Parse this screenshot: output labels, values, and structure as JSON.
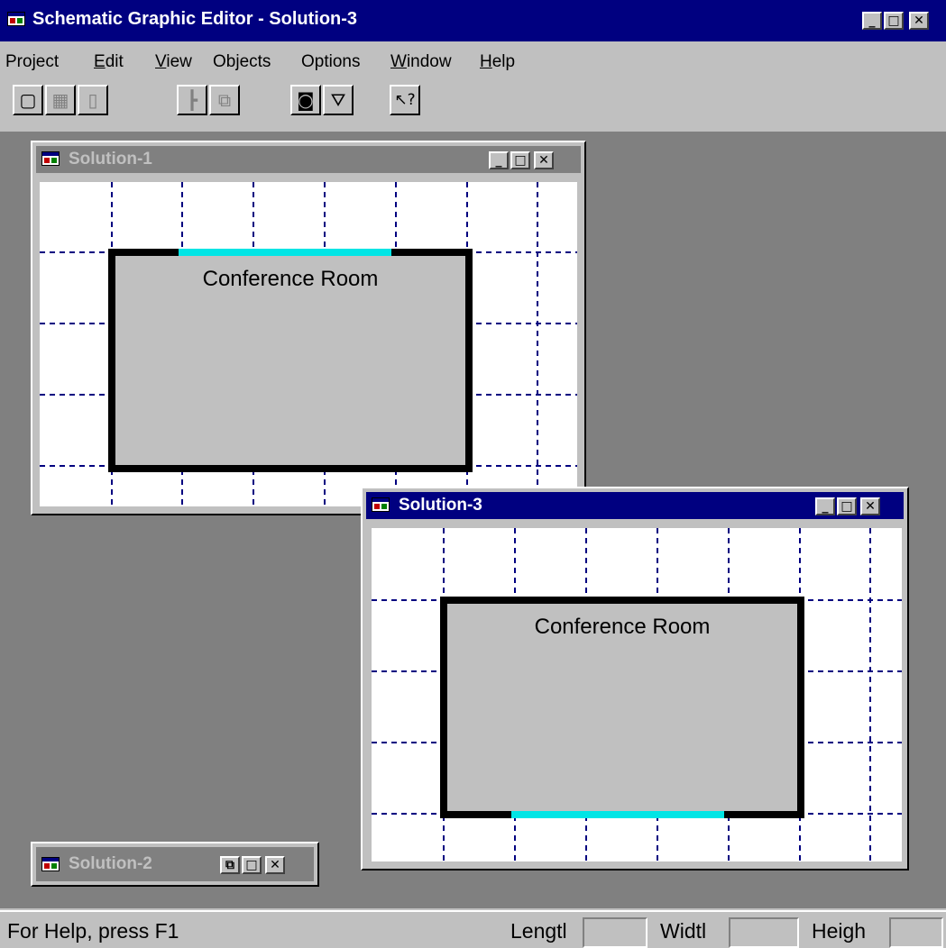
{
  "app": {
    "title": "Schematic Graphic Editor - Solution-3"
  },
  "menu": [
    {
      "label": "Project"
    },
    {
      "label": "Edit"
    },
    {
      "label": "View"
    },
    {
      "label": "Objects"
    },
    {
      "label": "Options"
    },
    {
      "label": "Window"
    },
    {
      "label": "Help"
    }
  ],
  "toolbar": {
    "buttons": [
      {
        "icon": "select-frame-icon",
        "glyph": "▢",
        "enabled": true
      },
      {
        "icon": "fill-pattern-icon",
        "glyph": "▦",
        "enabled": false
      },
      {
        "icon": "column-icon",
        "glyph": "▯",
        "enabled": false
      },
      {
        "icon": "wall-junction-icon",
        "glyph": "┣",
        "enabled": false
      },
      {
        "icon": "overlap-icon",
        "glyph": "⧉",
        "enabled": false
      },
      {
        "icon": "camera-icon",
        "glyph": "◙",
        "enabled": true
      },
      {
        "icon": "camera-tripod-icon",
        "glyph": "⛛",
        "enabled": true
      },
      {
        "icon": "context-help-icon",
        "glyph": "↖?",
        "enabled": true
      }
    ]
  },
  "windows": {
    "solution1": {
      "title": "Solution-1",
      "room_label": "Conference Room",
      "active": false
    },
    "solution2": {
      "title": "Solution-2",
      "minimized": true
    },
    "solution3": {
      "title": "Solution-3",
      "room_label": "Conference Room",
      "active": true
    }
  },
  "statusbar": {
    "help_text": "For Help, press F1",
    "length_label": "Lengtl",
    "width_label": "Widtl",
    "height_label": "Heigh",
    "length_value": "",
    "width_value": "",
    "height_value": ""
  },
  "colors": {
    "active_title": "#000080",
    "inactive_title": "#808080",
    "mdi_background": "#808080",
    "door": "#00e5e5",
    "grid_line": "#000080"
  }
}
